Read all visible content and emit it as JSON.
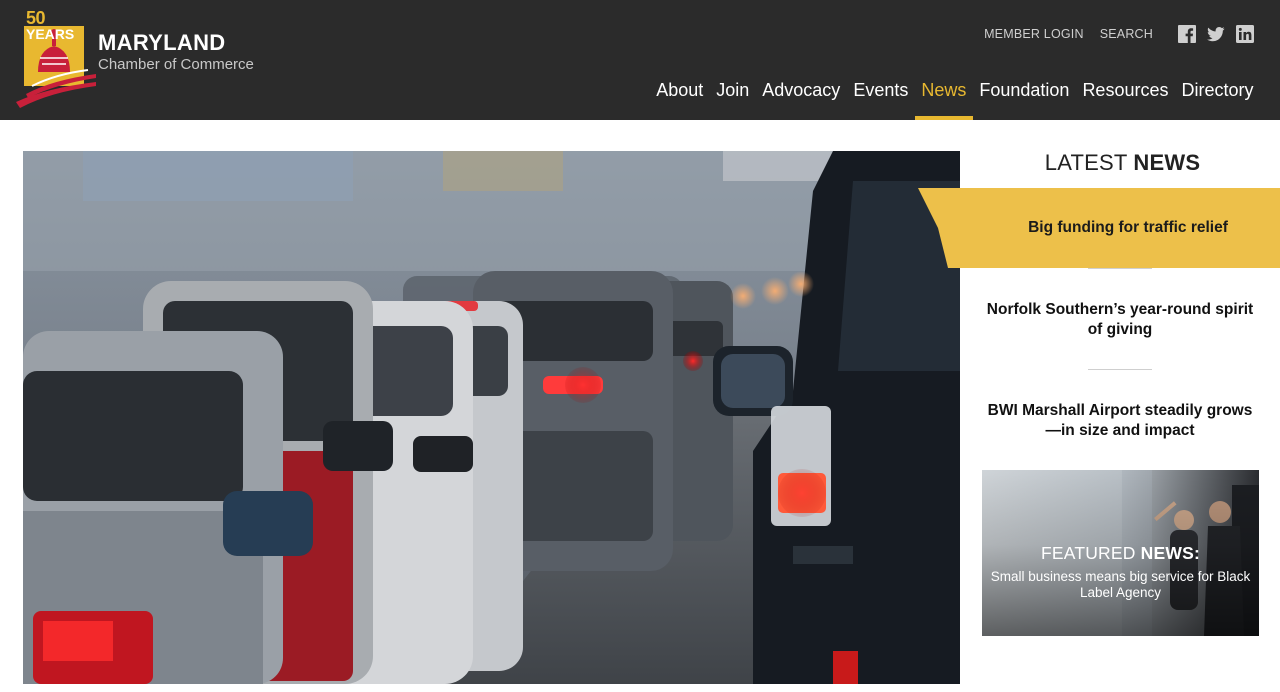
{
  "brand": {
    "anniversary_number": "50",
    "anniversary_word": "YEARS",
    "name": "MARYLAND",
    "subtitle": "Chamber of Commerce"
  },
  "utility_nav": {
    "member_login": "MEMBER LOGIN",
    "search": "SEARCH",
    "social_icons": [
      "facebook-icon",
      "twitter-icon",
      "linkedin-icon"
    ]
  },
  "main_nav": {
    "items": [
      {
        "label": "About"
      },
      {
        "label": "Join"
      },
      {
        "label": "Advocacy"
      },
      {
        "label": "Events"
      },
      {
        "label": "News",
        "active": true
      },
      {
        "label": "Foundation"
      },
      {
        "label": "Resources"
      },
      {
        "label": "Directory"
      }
    ]
  },
  "sidebar": {
    "title_light": "LATEST",
    "title_bold": "NEWS",
    "news": [
      {
        "title": "Big funding for traffic relief",
        "active": true
      },
      {
        "title": "Norfolk Southern’s year-round spirit of giving"
      },
      {
        "title": "BWI Marshall Airport steadily grows—in size and impact"
      }
    ],
    "featured": {
      "label_light": "FEATURED",
      "label_bold": "NEWS:",
      "text": "Small business means big service for Black Label Agency"
    }
  },
  "colors": {
    "header_bg": "#2b2b2b",
    "accent": "#e8b830",
    "active_card": "#edc04a"
  }
}
